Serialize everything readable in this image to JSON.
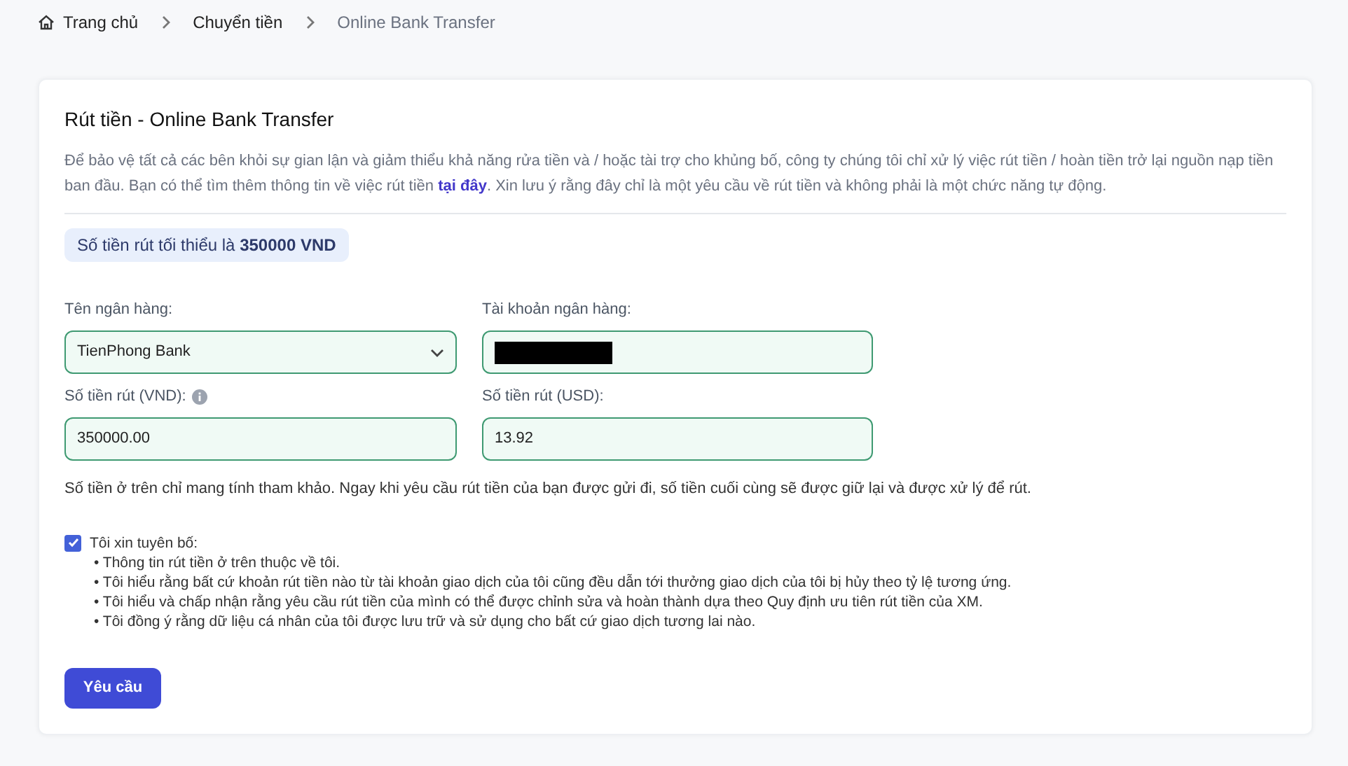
{
  "breadcrumb": [
    {
      "label": "Trang chủ",
      "kind": "home"
    },
    {
      "label": "Chuyển tiền",
      "kind": "link"
    },
    {
      "label": "Online Bank Transfer",
      "kind": "current"
    }
  ],
  "card": {
    "title": "Rút tiền - Online Bank Transfer",
    "intro": {
      "before": "Để bảo vệ tất cả các bên khỏi sự gian lận và giảm thiểu khả năng rửa tiền và / hoặc tài trợ cho khủng bố, công ty chúng tôi chỉ xử lý việc rút tiền / hoàn tiền trở lại nguồn nạp tiền ban đầu. Bạn có thể tìm thêm thông tin về việc rút tiền ",
      "link": "tại đây",
      "after": ". Xin lưu ý rằng đây chỉ là một yêu cầu về rút tiền và không phải là một chức năng tự động."
    },
    "minimum": "Số tiền rút tối thiểu là **350000 VND**",
    "fields": [
      {
        "label": "Tên ngân hàng:",
        "kind": "select",
        "value": "TienPhong Bank"
      },
      {
        "label": "Tài khoản ngân hàng:",
        "kind": "redacted"
      },
      {
        "label": "Số tiền rút (VND):",
        "kind": "input",
        "value": "350000.00",
        "info": true
      },
      {
        "label": "Số tiền rút (USD):",
        "kind": "input",
        "value": "13.92"
      }
    ],
    "note": "Số tiền ở trên chỉ mang tính tham khảo. Ngay khi yêu cầu rút tiền của bạn được gửi đi, số tiền cuối cùng sẽ được giữ lại và được xử lý để rút.",
    "declaration": {
      "label": "Tôi xin tuyên bố:",
      "checked": true,
      "items": [
        "• Thông tin rút tiền ở trên thuộc về tôi.",
        "• Tôi hiểu rằng bất cứ khoản rút tiền nào từ tài khoản giao dịch của tôi cũng đều dẫn tới thưởng giao dịch của tôi bị hủy theo tỷ lệ tương ứng.",
        "• Tôi hiểu và chấp nhận rằng yêu cầu rút tiền của mình có thể được chỉnh sửa và hoàn thành dựa theo Quy định ưu tiên rút tiền của XM.",
        "• Tôi đồng ý rằng dữ liệu cá nhân của tôi được lưu trữ và sử dụng cho bất cứ giao dịch tương lai nào."
      ]
    },
    "button": "Yêu cầu"
  }
}
